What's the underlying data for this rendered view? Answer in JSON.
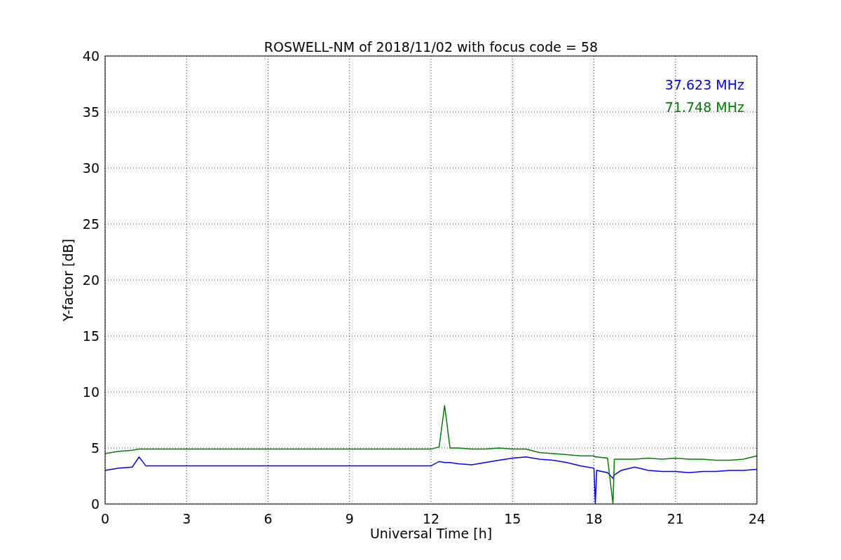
{
  "chart": {
    "chart_data": {
      "type": "line",
      "title": "ROSWELL-NM of 2018/11/02 with focus code = 58",
      "xlabel": "Universal Time [h]",
      "ylabel": "Y-factor [dB]",
      "xlim": [
        0,
        24
      ],
      "ylim": [
        0,
        40
      ],
      "xticks": [
        0,
        3,
        6,
        9,
        12,
        15,
        18,
        21,
        24
      ],
      "yticks": [
        0,
        5,
        10,
        15,
        20,
        25,
        30,
        35,
        40
      ],
      "grid": true,
      "x": [
        0,
        0.5,
        1,
        1.25,
        1.5,
        2,
        3,
        4,
        5,
        6,
        7,
        8,
        9,
        10,
        11,
        12,
        12.3,
        12.5,
        12.7,
        13,
        13.5,
        14,
        14.5,
        15,
        15.5,
        16,
        16.5,
        17,
        17.5,
        18,
        18.05,
        18.1,
        18.5,
        18.7,
        18.75,
        19,
        19.5,
        20,
        20.5,
        21,
        21.5,
        22,
        22.5,
        23,
        23.5,
        24
      ],
      "series": [
        {
          "name": "37.623 MHz",
          "color": "#0000ff",
          "values": [
            3.0,
            3.2,
            3.3,
            4.2,
            3.4,
            3.4,
            3.4,
            3.4,
            3.4,
            3.4,
            3.4,
            3.4,
            3.4,
            3.4,
            3.4,
            3.4,
            3.8,
            3.7,
            3.7,
            3.6,
            3.5,
            3.7,
            3.9,
            4.1,
            4.2,
            4.0,
            3.9,
            3.7,
            3.4,
            3.2,
            0,
            3.0,
            2.8,
            2.3,
            2.6,
            3.0,
            3.3,
            3.0,
            2.9,
            2.9,
            2.8,
            2.9,
            2.9,
            3.0,
            3.0,
            3.1
          ]
        },
        {
          "name": "71.748 MHz",
          "color": "#008000",
          "values": [
            4.5,
            4.7,
            4.8,
            4.9,
            4.9,
            4.9,
            4.9,
            4.9,
            4.9,
            4.9,
            4.9,
            4.9,
            4.9,
            4.9,
            4.9,
            4.9,
            5.1,
            8.8,
            5.0,
            5.0,
            4.9,
            4.9,
            5.0,
            4.9,
            4.9,
            4.6,
            4.5,
            4.4,
            4.3,
            4.3,
            4.2,
            4.2,
            4.1,
            0,
            4.0,
            4.0,
            4.0,
            4.1,
            4.0,
            4.1,
            4.0,
            4.0,
            3.9,
            3.9,
            4.0,
            4.3
          ]
        }
      ]
    }
  }
}
